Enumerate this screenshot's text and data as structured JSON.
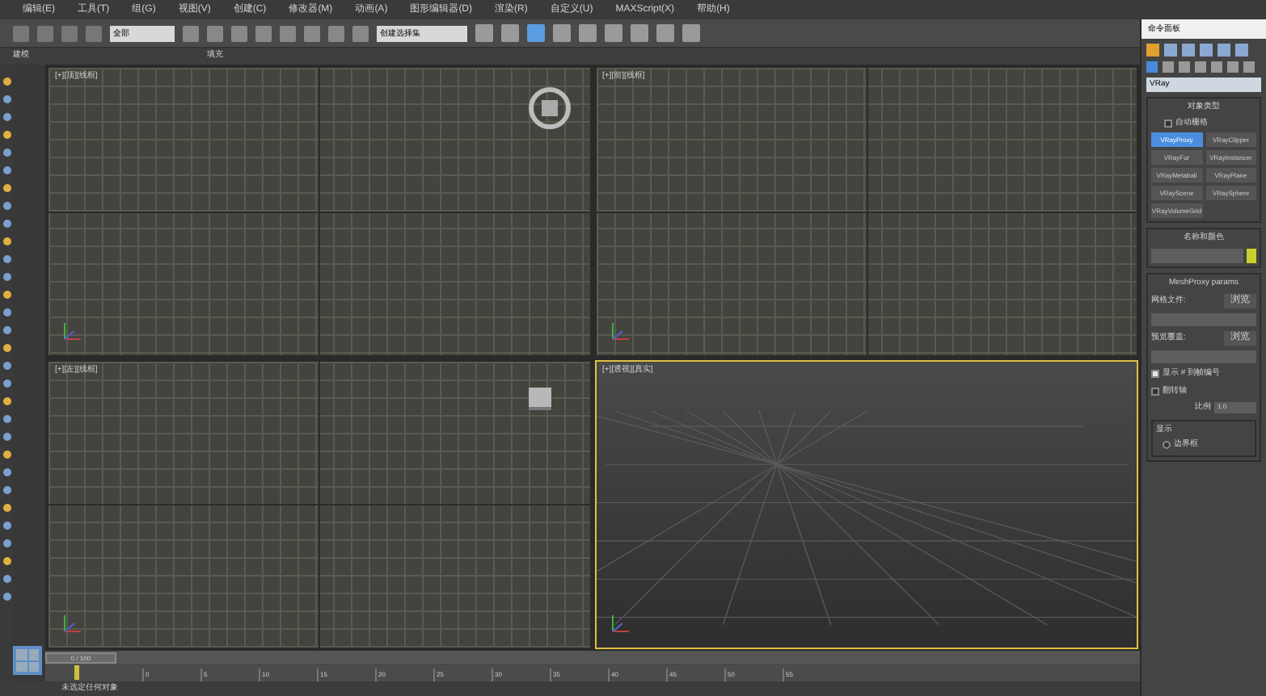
{
  "menu": [
    "编辑(E)",
    "工具(T)",
    "组(G)",
    "视图(V)",
    "创建(C)",
    "修改器(M)",
    "动画(A)",
    "图形编辑器(D)",
    "渲染(R)",
    "自定义(U)",
    "MAXScript(X)",
    "帮助(H)"
  ],
  "toolbar": {
    "filter": "全部",
    "selection_set": "创建选择集"
  },
  "ribbon": [
    "建模",
    "填充"
  ],
  "viewports": [
    {
      "label": "[+][顶][线框]",
      "kind": "grid",
      "active": false
    },
    {
      "label": "[+][前][线框]",
      "kind": "grid",
      "active": false
    },
    {
      "label": "[+][左][线框]",
      "kind": "grid",
      "active": false
    },
    {
      "label": "[+][透视][真实]",
      "kind": "perspective",
      "active": true
    }
  ],
  "command_panel": {
    "title": "命令面板",
    "category": "VRay",
    "object_type": {
      "title": "对象类型",
      "autogrid": {
        "label": "自动栅格",
        "checked": false
      },
      "buttons": [
        {
          "label": "VRayProxy",
          "selected": true
        },
        {
          "label": "VRayClipper",
          "selected": false
        },
        {
          "label": "VRayFur",
          "selected": false
        },
        {
          "label": "VRayInstancer",
          "selected": false
        },
        {
          "label": "VRayMetaball",
          "selected": false
        },
        {
          "label": "VRayPlane",
          "selected": false
        },
        {
          "label": "VRayScene",
          "selected": false
        },
        {
          "label": "VRaySphere",
          "selected": false
        },
        {
          "label": "VRayVolumeGrid",
          "selected": false
        }
      ]
    },
    "name_color": {
      "title": "名称和颜色"
    },
    "params": {
      "title": "MeshProxy params",
      "mesh_file": "网格文件:",
      "browse_1": "浏览",
      "preview": "预览覆盖:",
      "browse_2": "浏览",
      "options": [
        {
          "label": "显示 # 到帧编号",
          "checked": true
        },
        {
          "label": "翻转轴",
          "checked": false
        }
      ],
      "scale_label": "比例",
      "scale_value": "1.0",
      "display": "显示",
      "display_options": [
        {
          "label": "边界框",
          "selected": false
        }
      ]
    }
  },
  "timeline": {
    "frame": "0 / 100",
    "level": 0.0
  },
  "ruler": [
    "0",
    "5",
    "10",
    "15",
    "20",
    "25",
    "30",
    "35",
    "40",
    "45",
    "50",
    "55"
  ],
  "status": "未选定任何对象"
}
